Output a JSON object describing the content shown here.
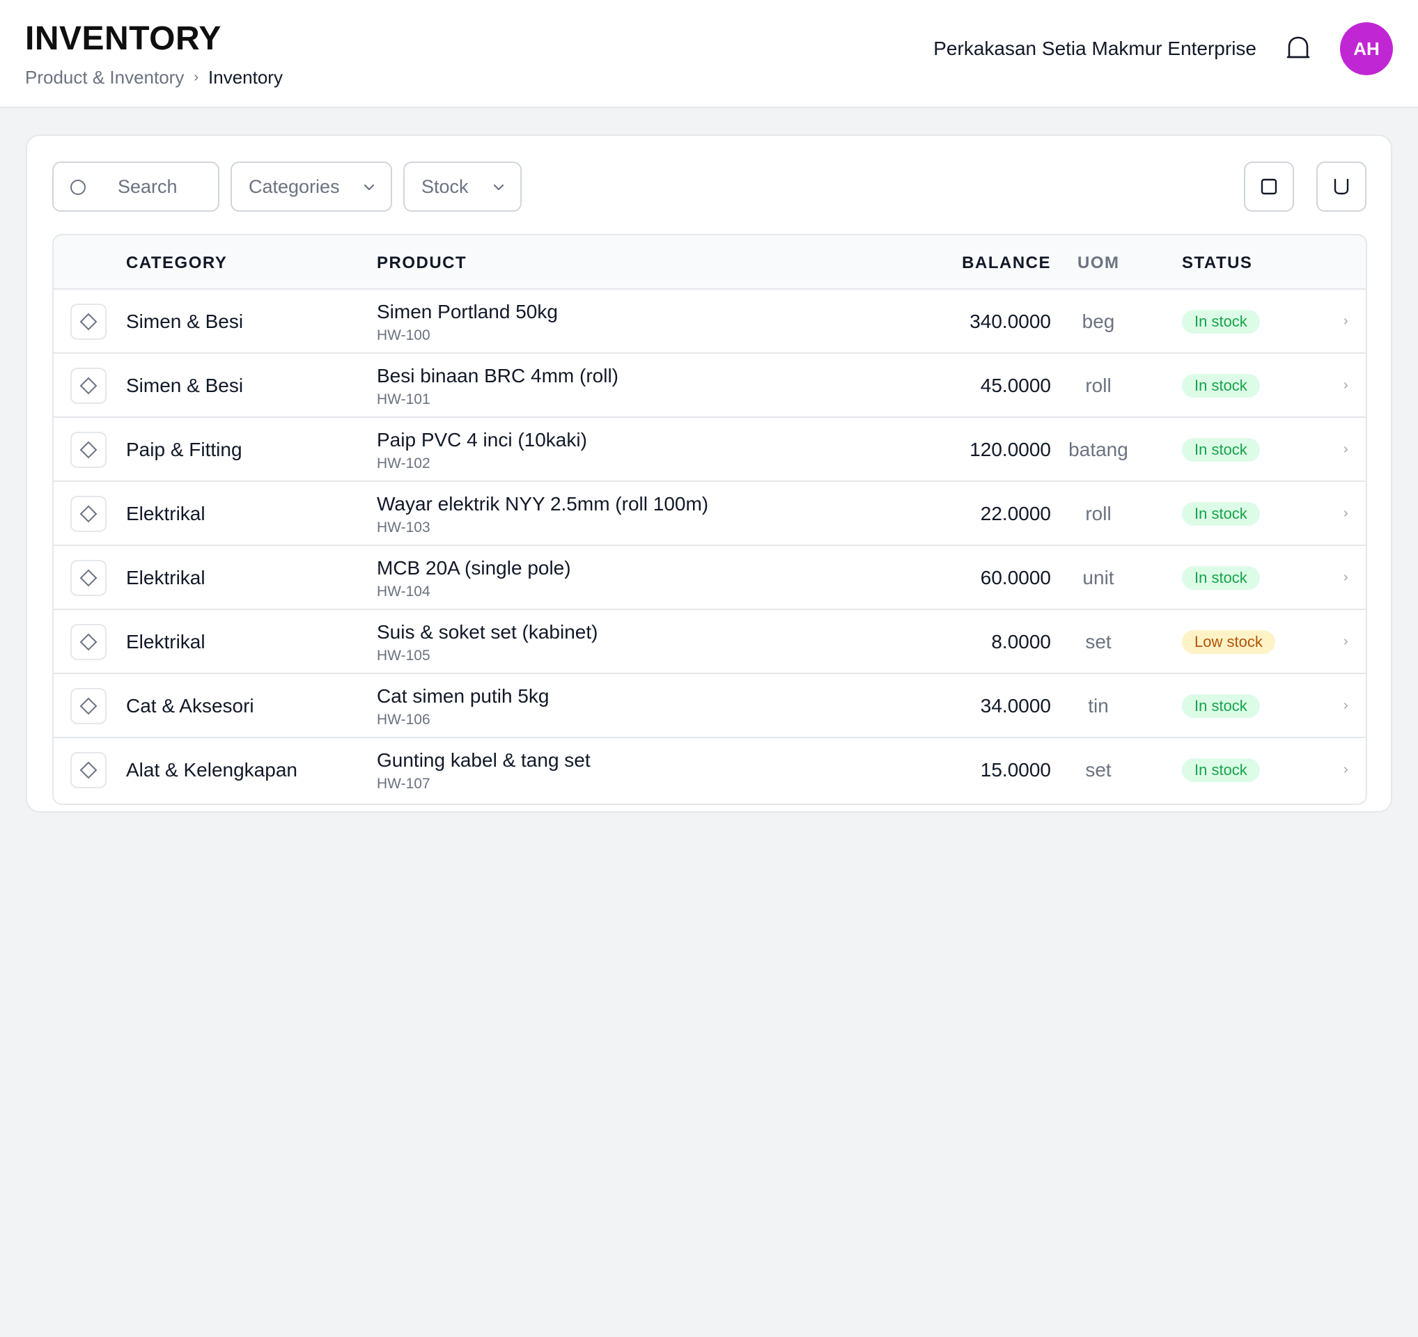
{
  "header": {
    "title": "INVENTORY",
    "breadcrumb": {
      "parent": "Product & Inventory",
      "separator": "›",
      "current": "Inventory"
    },
    "company": "Perkakasan Setia Makmur Enterprise",
    "bell_icon": "bell-icon",
    "avatar_initials": "AH",
    "avatar_color": "#c026d3"
  },
  "toolbar": {
    "search_placeholder": "Search",
    "categories_label": "Categories",
    "stock_label": "Stock",
    "action_icons": [
      "square-icon",
      "bucket-icon"
    ]
  },
  "table": {
    "columns": {
      "category": "CATEGORY",
      "product": "PRODUCT",
      "balance": "BALANCE",
      "uom": "UOM",
      "status": "STATUS"
    },
    "rows": [
      {
        "category": "Simen & Besi",
        "product": "Simen Portland 50kg",
        "sku": "HW-100",
        "balance": "340.0000",
        "uom": "beg",
        "status": "In stock",
        "status_type": "in"
      },
      {
        "category": "Simen & Besi",
        "product": "Besi binaan BRC 4mm (roll)",
        "sku": "HW-101",
        "balance": "45.0000",
        "uom": "roll",
        "status": "In stock",
        "status_type": "in"
      },
      {
        "category": "Paip & Fitting",
        "product": "Paip PVC 4 inci (10kaki)",
        "sku": "HW-102",
        "balance": "120.0000",
        "uom": "batang",
        "status": "In stock",
        "status_type": "in"
      },
      {
        "category": "Elektrikal",
        "product": "Wayar elektrik NYY 2.5mm (roll 100m)",
        "sku": "HW-103",
        "balance": "22.0000",
        "uom": "roll",
        "status": "In stock",
        "status_type": "in"
      },
      {
        "category": "Elektrikal",
        "product": "MCB 20A (single pole)",
        "sku": "HW-104",
        "balance": "60.0000",
        "uom": "unit",
        "status": "In stock",
        "status_type": "in"
      },
      {
        "category": "Elektrikal",
        "product": "Suis & soket set (kabinet)",
        "sku": "HW-105",
        "balance": "8.0000",
        "uom": "set",
        "status": "Low stock",
        "status_type": "low"
      },
      {
        "category": "Cat & Aksesori",
        "product": "Cat simen putih 5kg",
        "sku": "HW-106",
        "balance": "34.0000",
        "uom": "tin",
        "status": "In stock",
        "status_type": "in"
      },
      {
        "category": "Alat & Kelengkapan",
        "product": "Gunting kabel & tang set",
        "sku": "HW-107",
        "balance": "15.0000",
        "uom": "set",
        "status": "In stock",
        "status_type": "in"
      }
    ],
    "row_chevron": "›",
    "row_icon": "tag-icon"
  },
  "colors": {
    "in_stock_bg": "#dcfce7",
    "in_stock_text": "#16a34a",
    "low_stock_bg": "#fef3c7",
    "low_stock_text": "#b45309"
  }
}
